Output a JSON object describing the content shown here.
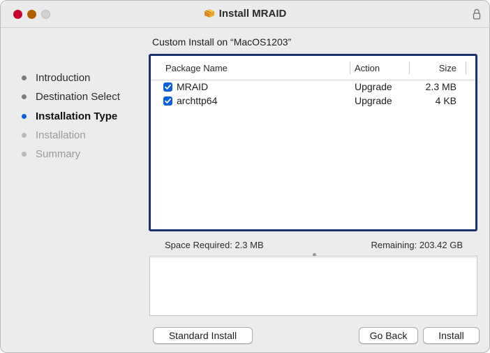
{
  "window": {
    "title": "Install MRAID"
  },
  "sidebar": {
    "steps": [
      {
        "label": "Introduction",
        "state": "done"
      },
      {
        "label": "Destination Select",
        "state": "done"
      },
      {
        "label": "Installation Type",
        "state": "active"
      },
      {
        "label": "Installation",
        "state": "pending"
      },
      {
        "label": "Summary",
        "state": "pending"
      }
    ]
  },
  "main": {
    "heading": "Custom Install on “MacOS1203”",
    "table": {
      "columns": [
        "Package Name",
        "Action",
        "Size"
      ],
      "rows": [
        {
          "checked": true,
          "name": "MRAID",
          "action": "Upgrade",
          "size": "2.3 MB"
        },
        {
          "checked": true,
          "name": "archttp64",
          "action": "Upgrade",
          "size": "4 KB"
        }
      ]
    },
    "space_required": "Space Required:  2.3 MB",
    "remaining": "Remaining:  203.42 GB"
  },
  "buttons": {
    "standard_install": "Standard Install",
    "go_back": "Go Back",
    "install": "Install"
  },
  "colors": {
    "accent": "#0b5fd7",
    "table_focus_border": "#1a2f6c",
    "close": "#c4062c",
    "minimize": "#b25f00"
  },
  "icons": {
    "title": "package-icon",
    "lock": "lock-icon",
    "checkbox": "checkmark-icon"
  }
}
